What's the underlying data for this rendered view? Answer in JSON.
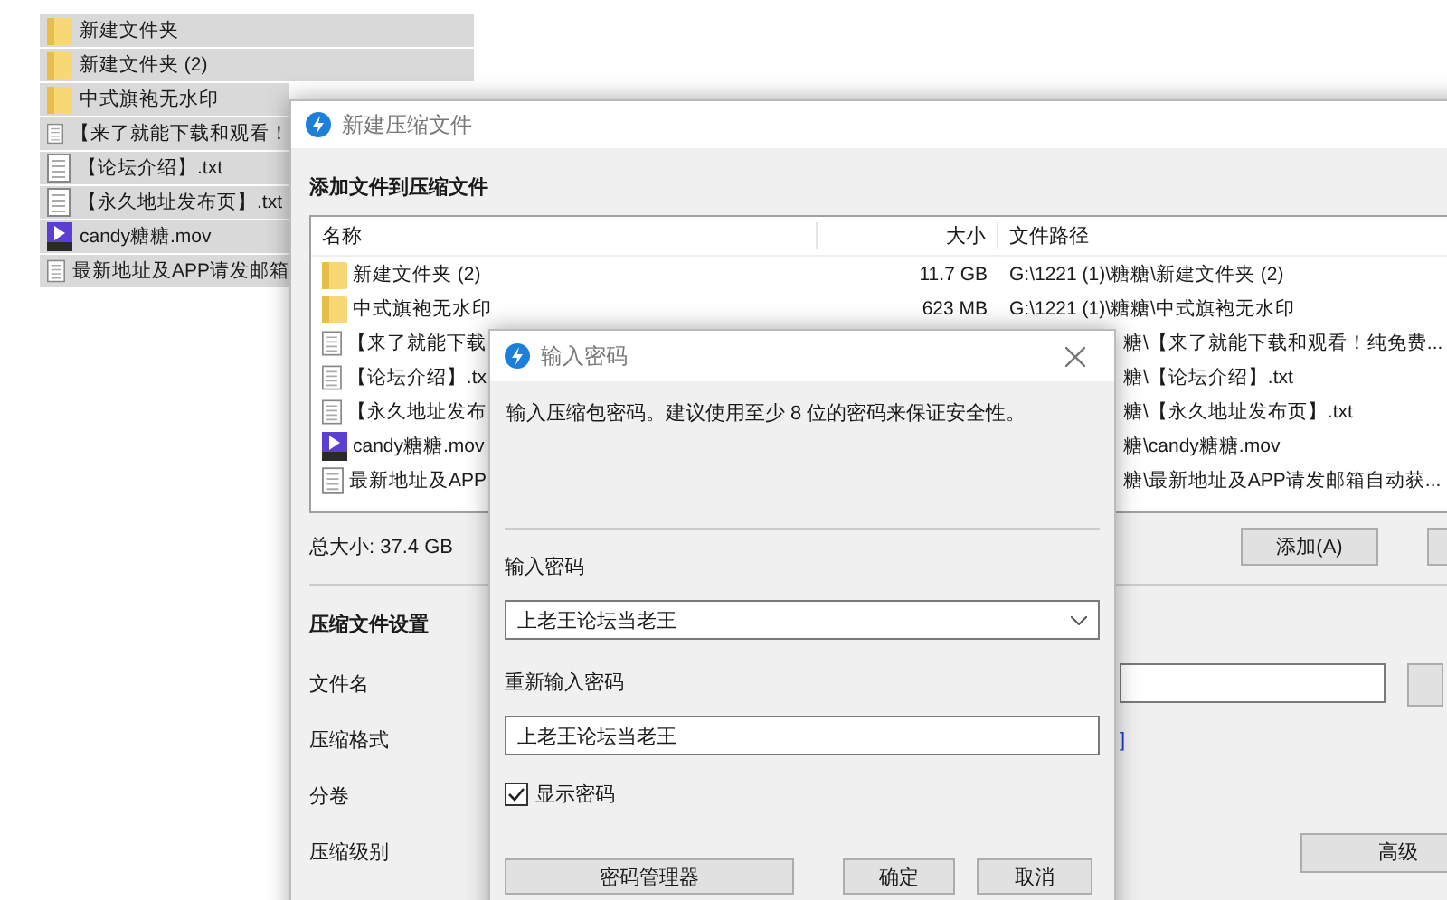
{
  "explorer": {
    "items": [
      {
        "kind": "folder",
        "name": "新建文件夹"
      },
      {
        "kind": "folder",
        "name": "新建文件夹 (2)"
      },
      {
        "kind": "folder",
        "name": "中式旗袍无水印"
      },
      {
        "kind": "text",
        "name": "【来了就能下载和观看！"
      },
      {
        "kind": "text",
        "name": "【论坛介绍】.txt"
      },
      {
        "kind": "text",
        "name": "【永久地址发布页】.txt"
      },
      {
        "kind": "video",
        "name": "candy糖糖.mov"
      },
      {
        "kind": "text",
        "name": "最新地址及APP请发邮箱"
      }
    ]
  },
  "archive_window": {
    "title": "新建压缩文件",
    "heading": "添加文件到压缩文件",
    "columns": [
      "名称",
      "大小",
      "文件路径"
    ],
    "rows": [
      {
        "kind": "folder",
        "name": "新建文件夹 (2)",
        "size": "11.7 GB",
        "path": "G:\\1221 (1)\\糖糖\\新建文件夹 (2)",
        "covered": false
      },
      {
        "kind": "folder",
        "name": "中式旗袍无水印",
        "size": "623 MB",
        "path": "G:\\1221 (1)\\糖糖\\中式旗袍无水印",
        "covered": false
      },
      {
        "kind": "text",
        "name": "【来了就能下载",
        "path": "糖\\【来了就能下载和观看！纯免费...",
        "covered": true
      },
      {
        "kind": "text",
        "name": "【论坛介绍】.tx",
        "path": "糖\\【论坛介绍】.txt",
        "covered": true
      },
      {
        "kind": "text",
        "name": "【永久地址发布",
        "path": "糖\\【永久地址发布页】.txt",
        "covered": true
      },
      {
        "kind": "video",
        "name": "candy糖糖.mov",
        "path": "糖\\candy糖糖.mov",
        "covered": true
      },
      {
        "kind": "text",
        "name": "最新地址及APP",
        "path": "糖\\最新地址及APP请发邮箱自动获...",
        "covered": true
      }
    ],
    "total": "总大小: 37.4 GB",
    "add_button": "添加(A)",
    "settings_heading": "压缩文件设置",
    "settings_labels": [
      "文件名",
      "压缩格式",
      "分卷",
      "压缩级别"
    ],
    "format_link": "]",
    "advanced_button": "高级"
  },
  "password_dialog": {
    "title": "输入密码",
    "message": "输入压缩包密码。建议使用至少 8 位的密码来保证安全性。",
    "password_label": "输入密码",
    "password_value": "上老王论坛当老王",
    "confirm_label": "重新输入密码",
    "confirm_value": "上老王论坛当老王",
    "show_password": {
      "label": "显示密码",
      "checked": true
    },
    "buttons": [
      "密码管理器",
      "确定",
      "取消"
    ]
  }
}
